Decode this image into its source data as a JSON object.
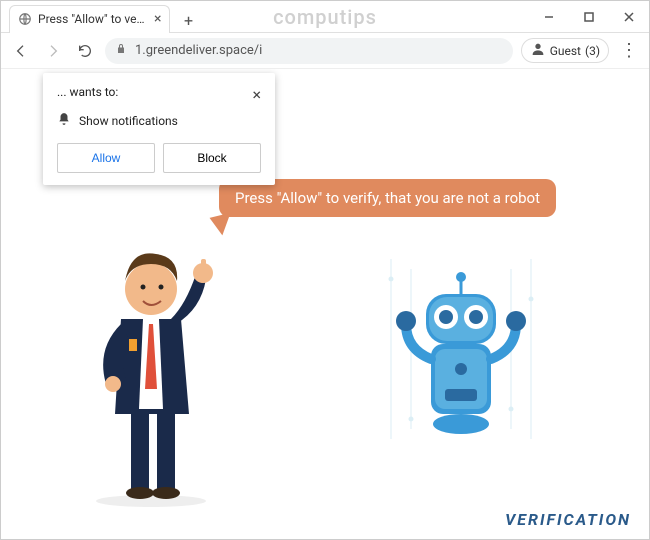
{
  "window": {
    "watermark": "computips"
  },
  "tab": {
    "title": "Press \"Allow\" to verify, that you a"
  },
  "toolbar": {
    "url": "1.greendeliver.space/i",
    "guest_label": "Guest",
    "guest_count": "(3)"
  },
  "prompt": {
    "wants_to": "... wants to:",
    "show_notifications": "Show notifications",
    "allow_label": "Allow",
    "block_label": "Block"
  },
  "speech": {
    "text": "Press \"Allow\" to verify, that you are not a robot"
  },
  "footer": {
    "verification": "VERIFICATION"
  }
}
